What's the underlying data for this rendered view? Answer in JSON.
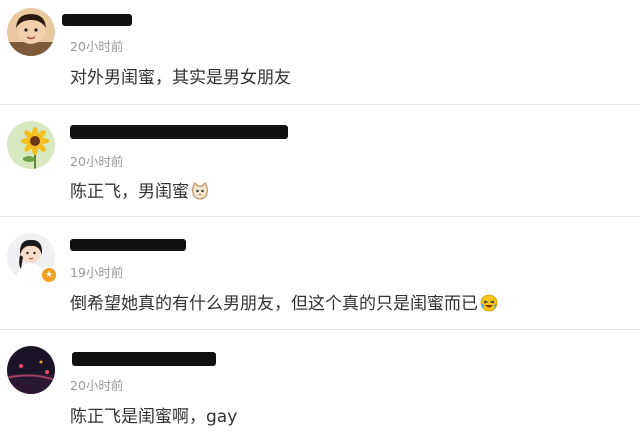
{
  "comments": [
    {
      "time": "20小时前",
      "text": "对外男闺蜜，其实是男女朋友",
      "emoji": ""
    },
    {
      "time": "20小时前",
      "text": "陈正飞，男闺蜜",
      "emoji": "cat-face-icon"
    },
    {
      "time": "19小时前",
      "text": "倒希望她真的有什么男朋友，但这个真的只是闺蜜而已",
      "emoji": "laughing-face-icon"
    },
    {
      "time": "20小时前",
      "text": "陈正飞是闺蜜啊，gay",
      "emoji": ""
    }
  ],
  "colors": {
    "time": "#999999",
    "text": "#333333",
    "divider": "#e6e6e6",
    "badge": "#f0a020"
  }
}
